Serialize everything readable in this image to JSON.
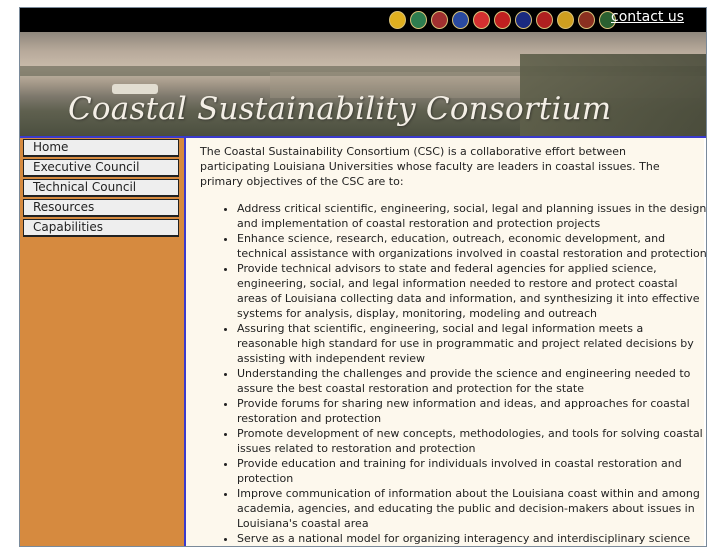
{
  "header": {
    "contact_label": "contact us",
    "university_logos": [
      {
        "icon": "lsu-logo-icon",
        "color": "#e0b020"
      },
      {
        "icon": "tulane-logo-icon",
        "color": "#2e7d4f"
      },
      {
        "icon": "uno-logo-icon",
        "color": "#a03030"
      },
      {
        "icon": "la-tech-logo-icon",
        "color": "#2a4aa0"
      },
      {
        "icon": "mcneese-logo-icon",
        "color": "#d43030"
      },
      {
        "icon": "ul-lafayette-logo-icon",
        "color": "#c02020"
      },
      {
        "icon": "southern-logo-icon",
        "color": "#1a2a80"
      },
      {
        "icon": "nicholls-logo-icon",
        "color": "#b02020"
      },
      {
        "icon": "grambling-logo-icon",
        "color": "#d0a020"
      },
      {
        "icon": "ulm-logo-icon",
        "color": "#8a3020"
      },
      {
        "icon": "southeastern-logo-icon",
        "color": "#2a6030"
      }
    ]
  },
  "banner": {
    "title": "Coastal Sustainability Consortium"
  },
  "sidebar": {
    "items": [
      {
        "label": "Home"
      },
      {
        "label": "Executive Council"
      },
      {
        "label": "Technical Council"
      },
      {
        "label": "Resources"
      },
      {
        "label": "Capabilities"
      }
    ]
  },
  "main": {
    "intro": "The Coastal Sustainability Consortium (CSC) is a collaborative effort between participating Louisiana Universities whose faculty are leaders in coastal issues. The primary objectives of the CSC are to:",
    "objectives": [
      "Address critical scientific, engineering, social, legal and planning issues in the design and implementation of coastal restoration and protection projects",
      "Enhance science, research, education, outreach, economic development, and technical assistance with organizations involved in coastal restoration and protection",
      "Provide technical advisors to state and federal agencies for applied science, engineering, social, and legal information needed to restore and protect coastal areas of Louisiana collecting data and information, and synthesizing it into effective systems for analysis, display, monitoring, modeling and outreach",
      "Assuring that scientific, engineering, social and legal information meets a reasonable high standard for use in programmatic and project related decisions by assisting with independent review",
      "Understanding the challenges and provide the science and engineering needed to assure the best coastal restoration and protection for the state",
      "Provide forums for sharing new information and ideas, and approaches for coastal restoration and protection",
      "Promote development of new concepts, methodologies, and tools for solving coastal issues related to restoration and protection",
      "Provide education and training for individuals involved in coastal restoration and protection",
      "Improve communication of information about the Louisiana coast within and among academia, agencies, and educating the public and decision-makers about issues in Louisiana's coastal area",
      "Serve as a national model for organizing interagency and interdisciplinary science and engineering to support planning and implementation of coastal restoration and"
    ]
  }
}
